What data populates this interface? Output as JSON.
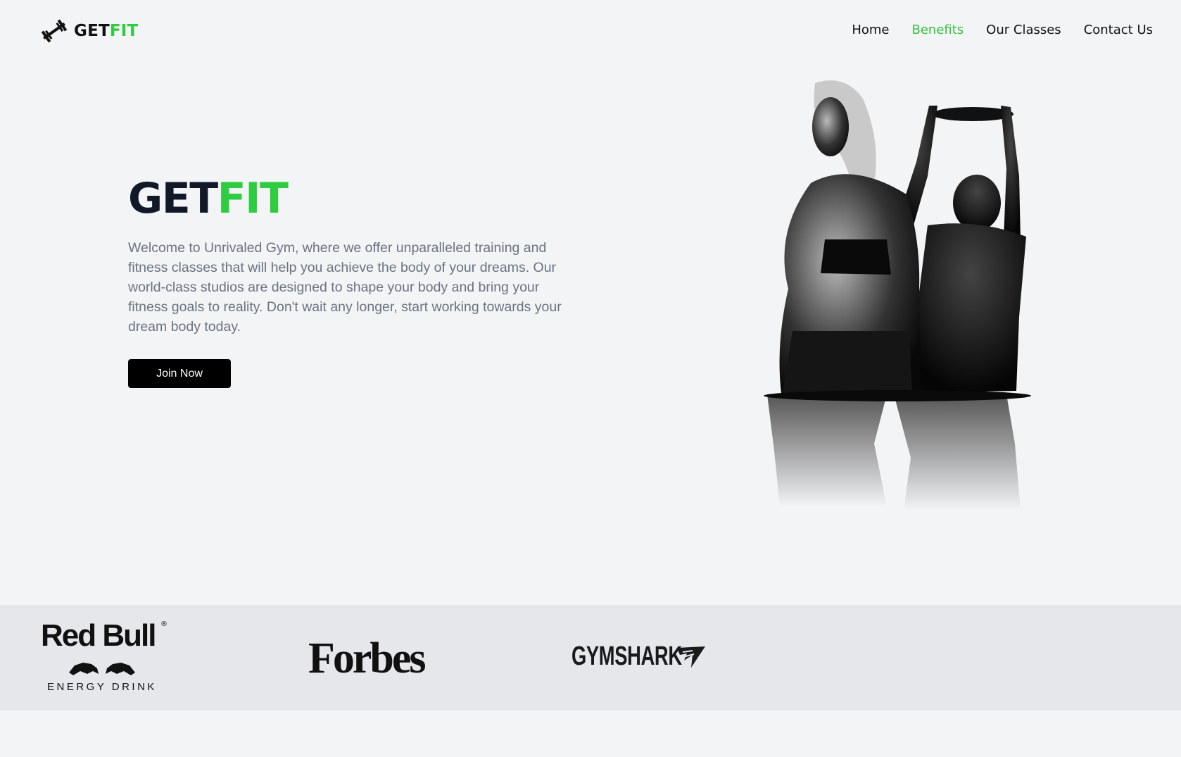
{
  "navbar": {
    "logo": {
      "part1": "GET",
      "part2": "FIT",
      "icon": "dumbbell-icon"
    },
    "links": [
      {
        "label": "Home",
        "active": false
      },
      {
        "label": "Benefits",
        "active": true
      },
      {
        "label": "Our Classes",
        "active": false
      },
      {
        "label": "Contact Us",
        "active": false
      }
    ]
  },
  "hero": {
    "title_part1": "GET",
    "title_part2": "FIT",
    "description": "Welcome to Unrivaled Gym, where we offer unparalleled training and fitness classes that will help you achieve the body of your dreams. Our world-class studios are designed to shape your body and bring your fitness goals to reality. Don't wait any longer, start working towards your dream body today.",
    "cta_label": "Join Now",
    "image": "fitness-couple-photo"
  },
  "partners": [
    {
      "name": "Red Bull",
      "wordmark": "Red Bull",
      "tagline": "ENERGY DRINK",
      "registered": "®"
    },
    {
      "name": "Forbes",
      "wordmark": "Forbes"
    },
    {
      "name": "Gymshark",
      "wordmark": "GYMSHARK"
    }
  ],
  "colors": {
    "accent": "#2ecc40",
    "background": "#f3f4f6",
    "partners_band": "#e5e7eb",
    "button": "#000000",
    "body_text": "#6b7280"
  }
}
